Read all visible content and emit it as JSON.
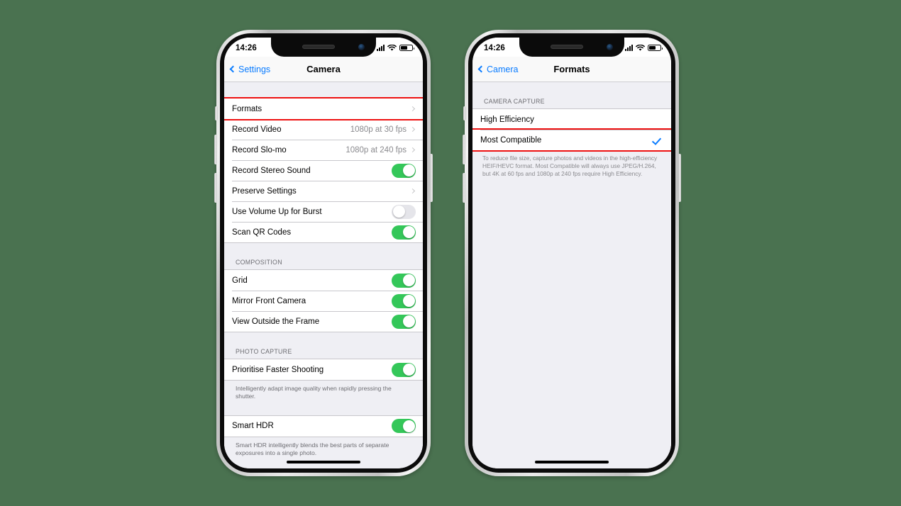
{
  "background_color": "#4a7250",
  "accent_blue": "#0a7cff",
  "toggle_green": "#34c759",
  "highlight_red": "#ee1111",
  "phone_left": {
    "status_bar": {
      "time": "14:26",
      "cellular": "signal-bars-icon",
      "wifi": "wifi-icon",
      "battery": "battery-icon"
    },
    "nav": {
      "back_label": "Settings",
      "title": "Camera"
    },
    "groups": [
      {
        "header": "",
        "rows": [
          {
            "label": "Formats",
            "value": "",
            "type": "disclosure",
            "highlighted": true
          },
          {
            "label": "Record Video",
            "value": "1080p at 30 fps",
            "type": "disclosure",
            "highlighted": false
          },
          {
            "label": "Record Slo-mo",
            "value": "1080p at 240 fps",
            "type": "disclosure",
            "highlighted": false
          },
          {
            "label": "Record Stereo Sound",
            "value": "",
            "type": "toggle-on",
            "highlighted": false
          },
          {
            "label": "Preserve Settings",
            "value": "",
            "type": "disclosure",
            "highlighted": false
          },
          {
            "label": "Use Volume Up for Burst",
            "value": "",
            "type": "toggle-off",
            "highlighted": false
          },
          {
            "label": "Scan QR Codes",
            "value": "",
            "type": "toggle-on",
            "highlighted": false
          }
        ],
        "footnote": ""
      },
      {
        "header": "COMPOSITION",
        "rows": [
          {
            "label": "Grid",
            "value": "",
            "type": "toggle-on",
            "highlighted": false
          },
          {
            "label": "Mirror Front Camera",
            "value": "",
            "type": "toggle-on",
            "highlighted": false
          },
          {
            "label": "View Outside the Frame",
            "value": "",
            "type": "toggle-on",
            "highlighted": false
          }
        ],
        "footnote": ""
      },
      {
        "header": "PHOTO CAPTURE",
        "rows": [
          {
            "label": "Prioritise Faster Shooting",
            "value": "",
            "type": "toggle-on",
            "highlighted": false
          }
        ],
        "footnote": "Intelligently adapt image quality when rapidly pressing the shutter."
      },
      {
        "header": "",
        "rows": [
          {
            "label": "Smart HDR",
            "value": "",
            "type": "toggle-on",
            "highlighted": false
          }
        ],
        "footnote": "Smart HDR intelligently blends the best parts of separate exposures into a single photo."
      }
    ]
  },
  "phone_right": {
    "status_bar": {
      "time": "14:26",
      "cellular": "signal-bars-icon",
      "wifi": "wifi-icon",
      "battery": "battery-icon"
    },
    "nav": {
      "back_label": "Camera",
      "title": "Formats"
    },
    "section_header": "CAMERA CAPTURE",
    "options": [
      {
        "label": "High Efficiency",
        "selected": false,
        "highlighted": false
      },
      {
        "label": "Most Compatible",
        "selected": true,
        "highlighted": true
      }
    ],
    "description": "To reduce file size, capture photos and videos in the high-efficiency HEIF/HEVC format. Most Compatible will always use JPEG/H.264, but 4K at 60 fps and 1080p at 240 fps require High Efficiency."
  }
}
